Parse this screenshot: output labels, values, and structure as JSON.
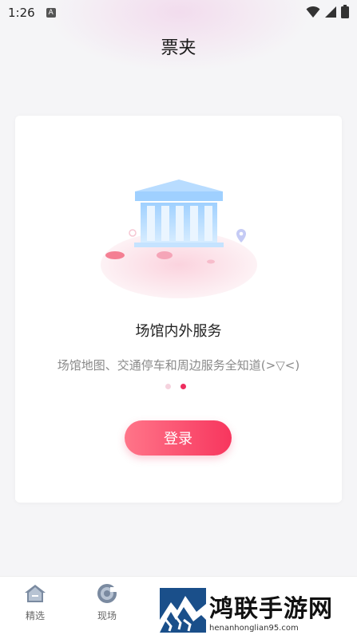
{
  "status_bar": {
    "time": "1:26",
    "app_icon_letter": "A"
  },
  "header": {
    "title": "票夹"
  },
  "card": {
    "heading": "场馆内外服务",
    "description": "场馆地图、交通停车和周边服务全知道(>▽<)",
    "pagination": {
      "total": 2,
      "active_index": 1
    },
    "login_label": "登录"
  },
  "bottom_nav": {
    "items": [
      {
        "label": "精选",
        "icon": "home-icon"
      },
      {
        "label": "现场",
        "icon": "live-icon"
      }
    ]
  },
  "watermark": {
    "title": "鸿联手游网",
    "url": "henanhonglian95.com"
  },
  "colors": {
    "accent": "#ee2d5e",
    "button_start": "#ff7589",
    "button_end": "#f7365e",
    "background": "#f5f5f7"
  }
}
